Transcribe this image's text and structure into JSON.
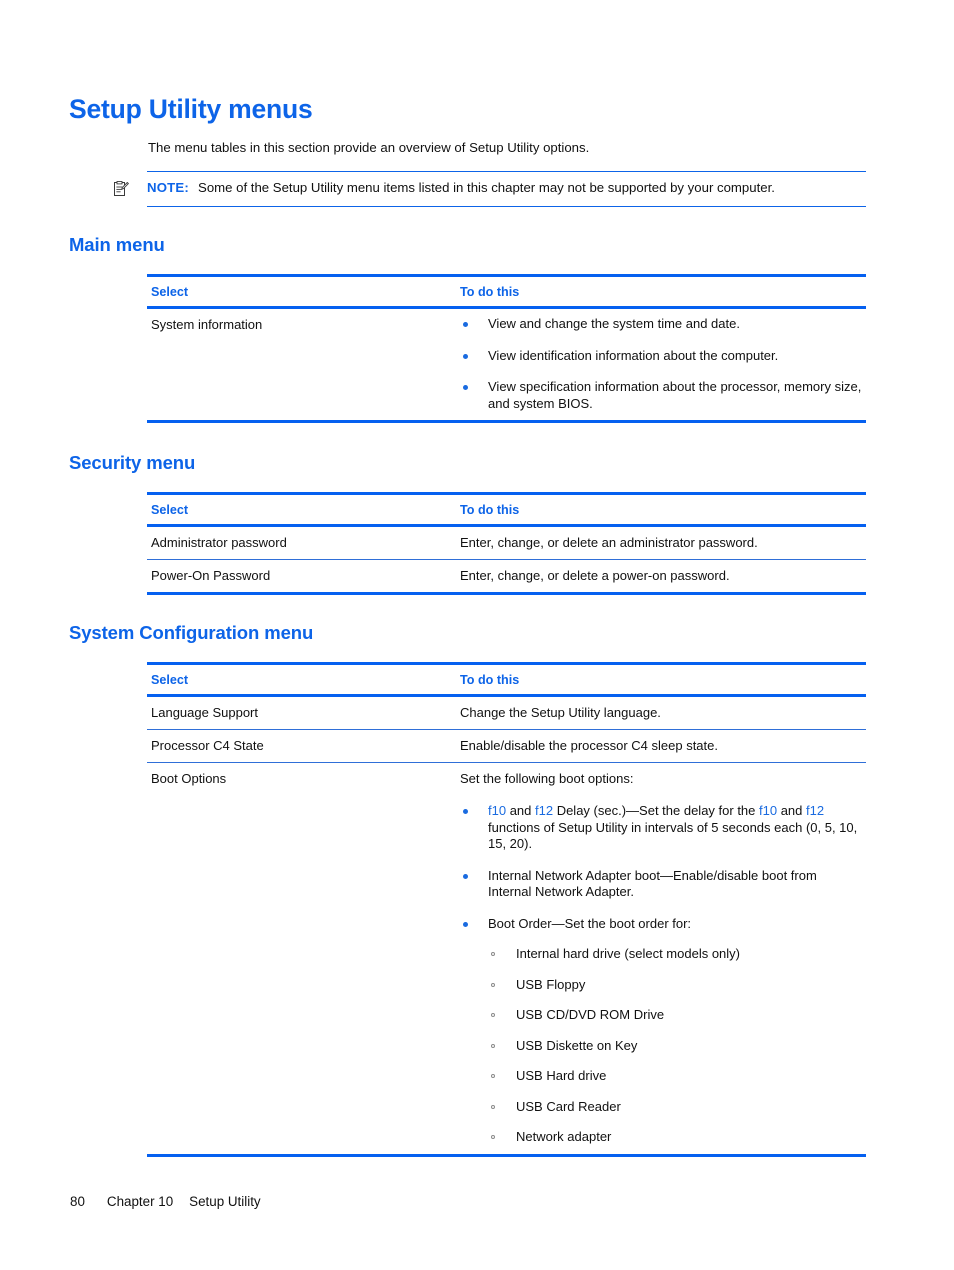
{
  "page": {
    "title": "Setup Utility menus",
    "intro": "The menu tables in this section provide an overview of Setup Utility options."
  },
  "note": {
    "icon": "note-clipboard-icon",
    "label": "NOTE:",
    "text": "Some of the Setup Utility menu items listed in this chapter may not be supported by your computer."
  },
  "sections": {
    "main": {
      "heading": "Main menu",
      "columns": {
        "select": "Select",
        "todo": "To do this"
      },
      "rows": [
        {
          "select": "System information",
          "bullets": [
            "View and change the system time and date.",
            "View identification information about the computer.",
            "View specification information about the processor, memory size, and system BIOS."
          ]
        }
      ]
    },
    "security": {
      "heading": "Security menu",
      "columns": {
        "select": "Select",
        "todo": "To do this"
      },
      "rows": [
        {
          "select": "Administrator password",
          "todo": "Enter, change, or delete an administrator password."
        },
        {
          "select": "Power-On Password",
          "todo": "Enter, change, or delete a power-on password."
        }
      ]
    },
    "system_configuration": {
      "heading": "System Configuration menu",
      "columns": {
        "select": "Select",
        "todo": "To do this"
      },
      "rows": [
        {
          "select": "Language Support",
          "todo": "Change the Setup Utility language."
        },
        {
          "select": "Processor C4 State",
          "todo": "Enable/disable the processor C4 sleep state."
        },
        {
          "select": "Boot Options",
          "todo": "Set the following boot options:",
          "bullets": [
            {
              "parts": [
                {
                  "t": "f10",
                  "link": true
                },
                {
                  "t": " and "
                },
                {
                  "t": "f12",
                  "link": true
                },
                {
                  "t": " Delay (sec.)—Set the delay for the "
                },
                {
                  "t": "f10",
                  "link": true
                },
                {
                  "t": " and "
                },
                {
                  "t": "f12",
                  "link": true
                },
                {
                  "t": " functions of Setup Utility in intervals of 5 seconds each (0, 5, 10, 15, 20)."
                }
              ]
            },
            {
              "parts": [
                {
                  "t": "Internal Network Adapter boot—Enable/disable boot from Internal Network Adapter."
                }
              ]
            },
            {
              "parts": [
                {
                  "t": "Boot Order—Set the boot order for:"
                }
              ],
              "subbullets": [
                "Internal hard drive (select models only)",
                "USB Floppy",
                "USB CD/DVD ROM Drive",
                "USB Diskette on Key",
                "USB Hard drive",
                "USB Card Reader",
                "Network adapter"
              ]
            }
          ]
        }
      ]
    }
  },
  "footer": {
    "page_number": "80",
    "chapter": "Chapter 10",
    "chapter_title": "Setup Utility"
  },
  "colors": {
    "heading_blue": "#0d64e8",
    "rule_blue": "#0560f0",
    "link_blue": "#1a6be0",
    "text": "#111111"
  }
}
